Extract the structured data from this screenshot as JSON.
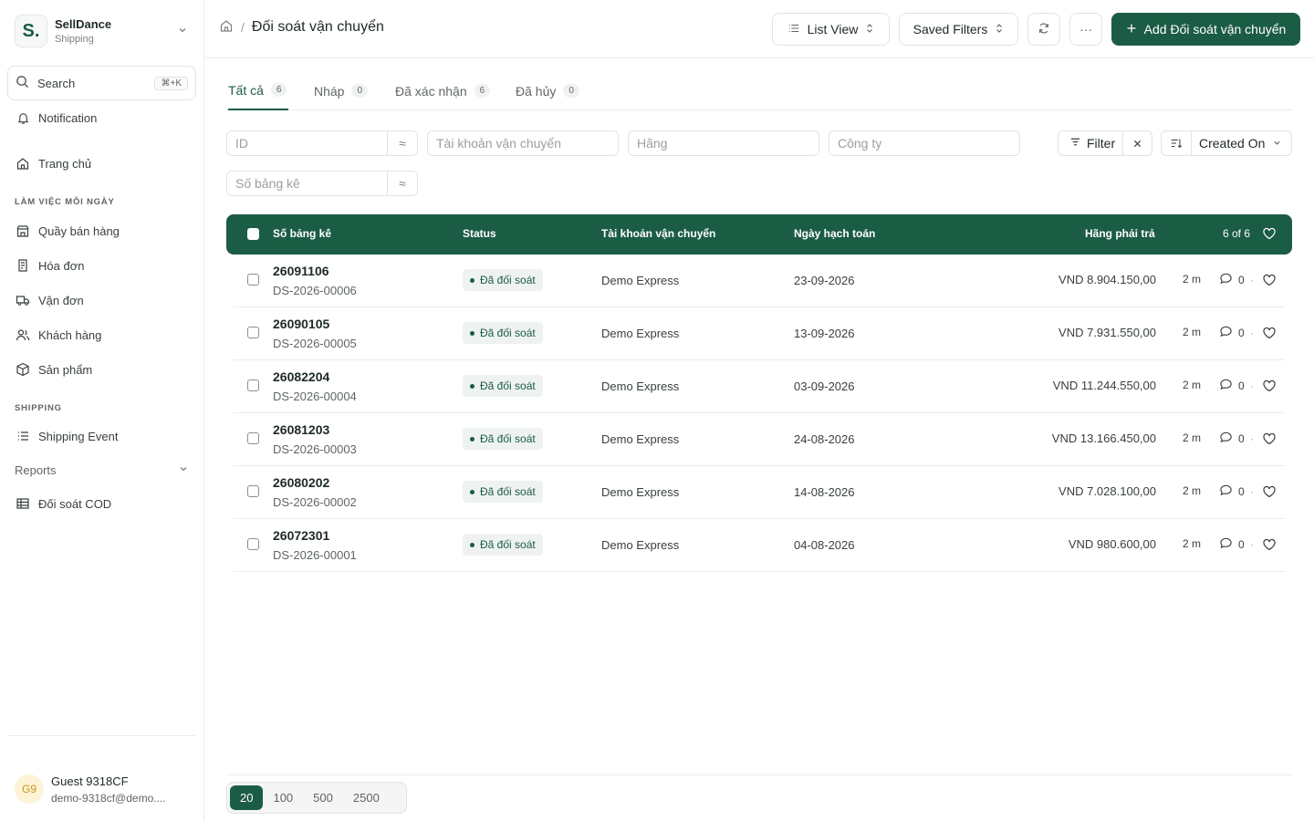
{
  "brand": {
    "logo_letter": "S.",
    "name": "SellDance",
    "subtitle": "Shipping"
  },
  "search": {
    "label": "Search",
    "shortcut": "⌘+K"
  },
  "sidebar": {
    "notification": "Notification",
    "home": "Trang chủ",
    "section_daily": "LÀM VIỆC MỖI NGÀY",
    "items_daily": [
      "Quầy bán hàng",
      "Hóa đơn",
      "Vận đơn",
      "Khách hàng",
      "Sản phẩm"
    ],
    "section_shipping": "SHIPPING",
    "shipping_event": "Shipping Event",
    "reports": "Reports",
    "cod": "Đối soát COD"
  },
  "user": {
    "initials": "G9",
    "name": "Guest 9318CF",
    "email": "demo-9318cf@demo...."
  },
  "header": {
    "title": "Đối soát vận chuyển",
    "list_view": "List View",
    "saved_filters": "Saved Filters",
    "more": "···",
    "add_button": "Add Đối soát vận chuyển"
  },
  "tabs": [
    {
      "label": "Tất cả",
      "count": "6"
    },
    {
      "label": "Nháp",
      "count": "0"
    },
    {
      "label": "Đã xác nhận",
      "count": "6"
    },
    {
      "label": "Đã hủy",
      "count": "0"
    }
  ],
  "filters": {
    "id": "ID",
    "account": "Tài khoản vận chuyển",
    "carrier": "Hãng",
    "company": "Công ty",
    "statement": "Số bảng kê",
    "filter_label": "Filter",
    "sort_label": "Created On"
  },
  "table": {
    "headers": {
      "statement": "Số bảng kê",
      "status": "Status",
      "account": "Tài khoản vận chuyển",
      "date": "Ngày hạch toán",
      "amount": "Hãng phải trả",
      "count": "6 of 6"
    },
    "rows": [
      {
        "id": "26091106",
        "code": "DS-2026-00006",
        "status": "Đã đối soát",
        "account": "Demo Express",
        "date": "23-09-2026",
        "amount": "VND 8.904.150,00",
        "age": "2 m",
        "comments": "0"
      },
      {
        "id": "26090105",
        "code": "DS-2026-00005",
        "status": "Đã đối soát",
        "account": "Demo Express",
        "date": "13-09-2026",
        "amount": "VND 7.931.550,00",
        "age": "2 m",
        "comments": "0"
      },
      {
        "id": "26082204",
        "code": "DS-2026-00004",
        "status": "Đã đối soát",
        "account": "Demo Express",
        "date": "03-09-2026",
        "amount": "VND 11.244.550,00",
        "age": "2 m",
        "comments": "0"
      },
      {
        "id": "26081203",
        "code": "DS-2026-00003",
        "status": "Đã đối soát",
        "account": "Demo Express",
        "date": "24-08-2026",
        "amount": "VND 13.166.450,00",
        "age": "2 m",
        "comments": "0"
      },
      {
        "id": "26080202",
        "code": "DS-2026-00002",
        "status": "Đã đối soát",
        "account": "Demo Express",
        "date": "14-08-2026",
        "amount": "VND 7.028.100,00",
        "age": "2 m",
        "comments": "0"
      },
      {
        "id": "26072301",
        "code": "DS-2026-00001",
        "status": "Đã đối soát",
        "account": "Demo Express",
        "date": "04-08-2026",
        "amount": "VND 980.600,00",
        "age": "2 m",
        "comments": "0"
      }
    ]
  },
  "pagination": {
    "sizes": [
      "20",
      "100",
      "500",
      "2500"
    ],
    "selected": "20"
  },
  "colors": {
    "accent": "#1b5c45",
    "badge_bg": "#eef3f0",
    "border": "#e1e4e2"
  }
}
